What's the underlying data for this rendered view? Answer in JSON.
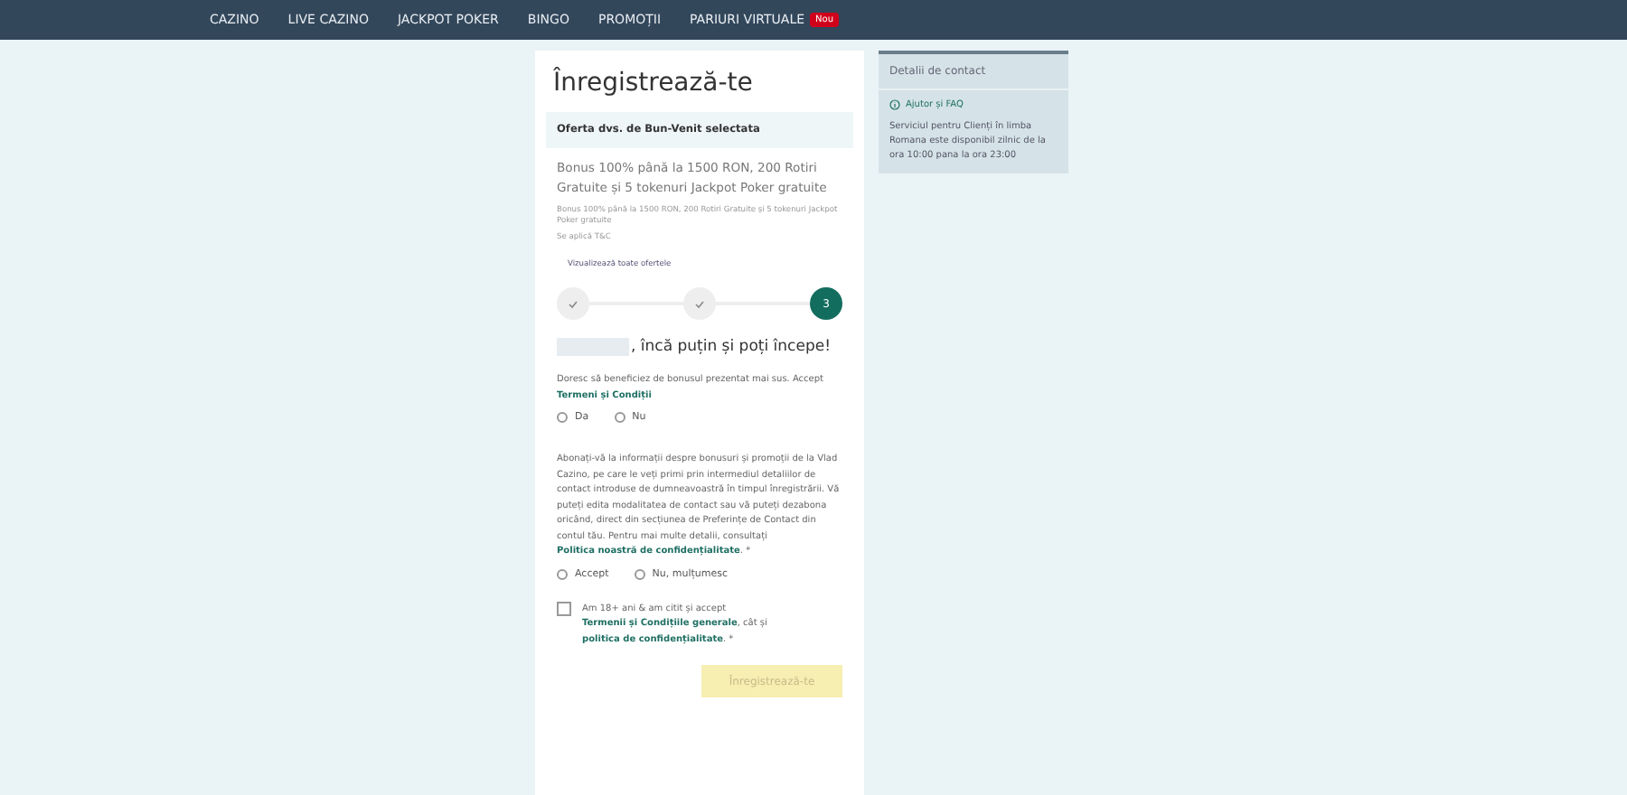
{
  "nav": {
    "items": [
      {
        "label": "CAZINO"
      },
      {
        "label": "LIVE CAZINO"
      },
      {
        "label": "JACKPOT POKER"
      },
      {
        "label": "BINGO"
      },
      {
        "label": "PROMOȚII"
      },
      {
        "label": "PARIURI VIRTUALE",
        "badge": "Nou"
      }
    ]
  },
  "form": {
    "title": "Înregistrează-te",
    "offer": {
      "heading": "Oferta dvs. de Bun-Venit selectata",
      "title": "Bonus 100% până la 1500 RON, 200 Rotiri Gratuite și 5 tokenuri Jackpot Poker gratuite",
      "detail": "Bonus 100% până la 1500 RON, 200 Rotiri Gratuite și 5 tokenuri Jackpot Poker gratuite",
      "terms": "Se aplică T&C",
      "view_all": "Vizualizează toate ofertele"
    },
    "steps": [
      {
        "done": true
      },
      {
        "done": true
      },
      {
        "done": false,
        "label": "3"
      }
    ],
    "greeting": ", încă puțin și poți începe!",
    "bonus_question": {
      "text": "Doresc să beneficiez de bonusul prezentat mai sus. Accept ",
      "link": "Termeni și Condiții",
      "options": [
        {
          "label": "Da",
          "selected": false
        },
        {
          "label": "Nu",
          "selected": false
        }
      ]
    },
    "marketing_question": {
      "text": "Abonați-vă la informații despre bonusuri și promoții de la Vlad Cazino, pe care le veți primi prin intermediul detaliilor de contact introduse de dumneavoastră în timpul înregistrării. Vă puteți edita modalitatea de contact sau vă puteți dezabona oricând, direct din secțiunea de Preferințe de Contact din contul tău. Pentru mai multe detalii, consultați ",
      "link": "Politica noastră de confidențialitate",
      "suffix": ". *",
      "options": [
        {
          "label": "Accept",
          "selected": false
        },
        {
          "label": "Nu, mulțumesc",
          "selected": false
        }
      ]
    },
    "age_consent": {
      "checked": false,
      "text": "Am 18+ ani & am citit și accept ",
      "link": "Termenii și Condițiile generale",
      "middle": ", cât și ",
      "link2": "politica de confidențialitate",
      "suffix": ". *"
    },
    "submit": {
      "label": "Înregistrează-te",
      "disabled": true
    }
  },
  "contact": {
    "title": "Detalii de contact",
    "help_link": "Ajutor și FAQ",
    "text": "Serviciul pentru Clienți în limba Romana este disponibil zilnic de la ora 10:00 pana la ora 23:00"
  }
}
